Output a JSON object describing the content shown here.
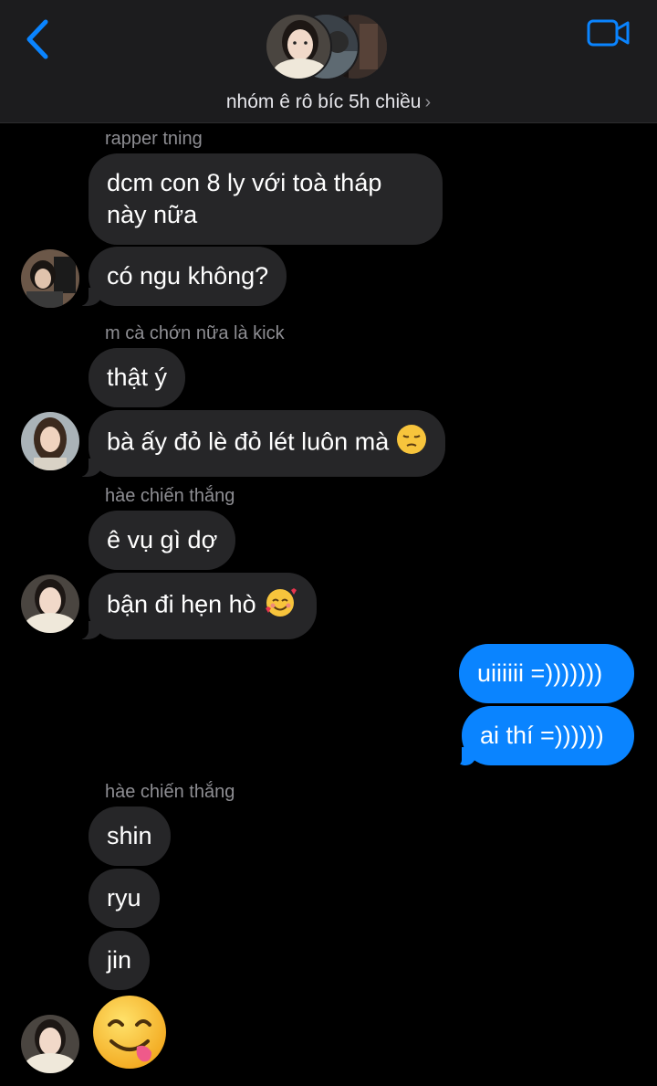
{
  "header": {
    "group_name": "nhóm ê rô bíc 5h chiều",
    "chevron": "›",
    "back_icon": "chevron-left-icon",
    "video_icon": "video-camera-icon",
    "accent": "#0a84ff"
  },
  "messages": {
    "sender_1": "rapper tning",
    "m1": "dcm con 8 ly với toà tháp này nữa",
    "m2": "có ngu không?",
    "sender_2": "m cà chớn nữa là kick",
    "m3": "thật ý",
    "m4": "bà ấy đỏ lè đỏ lét luôn mà",
    "sender_3": "hàe chiến thắng",
    "m5": "ê vụ gì dợ",
    "m6": "bận đi hẹn hò",
    "me1": "uiiiiii =)))))))",
    "me2": "ai thí =))))))",
    "sender_4": "hàe chiến thắng",
    "m7": "shin",
    "m8": "ryu",
    "m9": "jin"
  },
  "colors": {
    "incoming_bubble": "#262628",
    "outgoing_bubble": "#0a84ff",
    "sender_name": "#8e8e93"
  }
}
